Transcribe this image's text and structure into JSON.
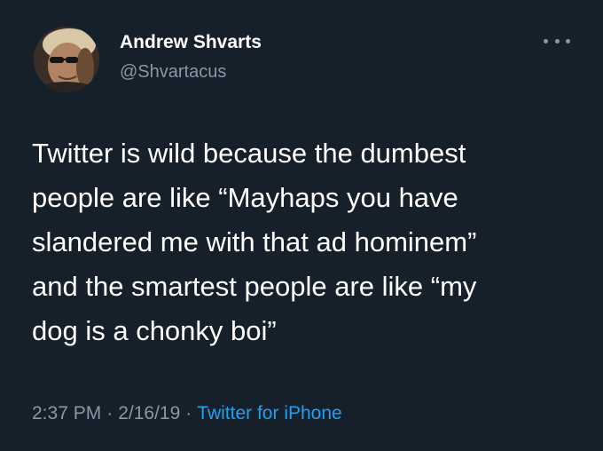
{
  "author": {
    "display_name": "Andrew Shvarts",
    "handle": "@Shvartacus"
  },
  "tweet": {
    "lines": [
      "Twitter is wild because the dumbest",
      "people are like “Mayhaps you have",
      "slandered me with that ad hominem”",
      "and the smartest people are like “my",
      "dog is a chonky boi”"
    ],
    "time": "2:37 PM",
    "date": "2/16/19",
    "separator": "·",
    "source": "Twitter for iPhone"
  },
  "icons": {
    "more": "more-options-icon",
    "avatar": "profile-photo"
  },
  "colors": {
    "background": "#15202b",
    "text_primary": "#ffffff",
    "text_secondary": "#8899a6",
    "link": "#1da1f2"
  }
}
